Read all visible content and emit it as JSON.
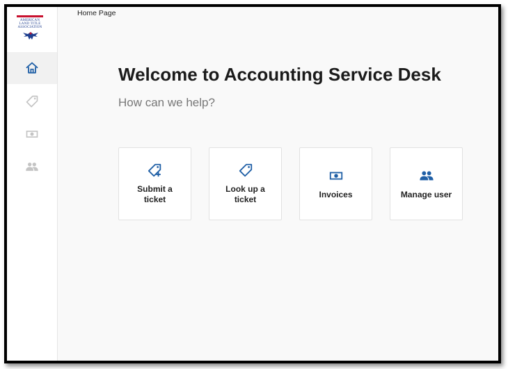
{
  "breadcrumb": "Home Page",
  "logo": {
    "line1": "AMERICAN",
    "line2": "LAND TITLE",
    "line3": "ASSOCIATION"
  },
  "sidebar": {
    "items": [
      {
        "name": "home",
        "icon": "home-icon",
        "active": true
      },
      {
        "name": "tickets",
        "icon": "tag-icon",
        "active": false
      },
      {
        "name": "invoices",
        "icon": "money-icon",
        "active": false
      },
      {
        "name": "users",
        "icon": "people-icon",
        "active": false
      }
    ]
  },
  "main": {
    "title": "Welcome to Accounting Service Desk",
    "subtitle": "How can we help?",
    "cards": [
      {
        "label": "Submit a ticket",
        "icon": "tag-plus-icon"
      },
      {
        "label": "Look up a ticket",
        "icon": "tag-icon"
      },
      {
        "label": "Invoices",
        "icon": "money-icon"
      },
      {
        "label": "Manage user",
        "icon": "people-icon"
      }
    ]
  },
  "colors": {
    "accent": "#1f5fa6",
    "sidebar_icon_inactive": "#c4c4c4",
    "logo_red": "#c8102e",
    "logo_blue": "#1f3f8f"
  }
}
